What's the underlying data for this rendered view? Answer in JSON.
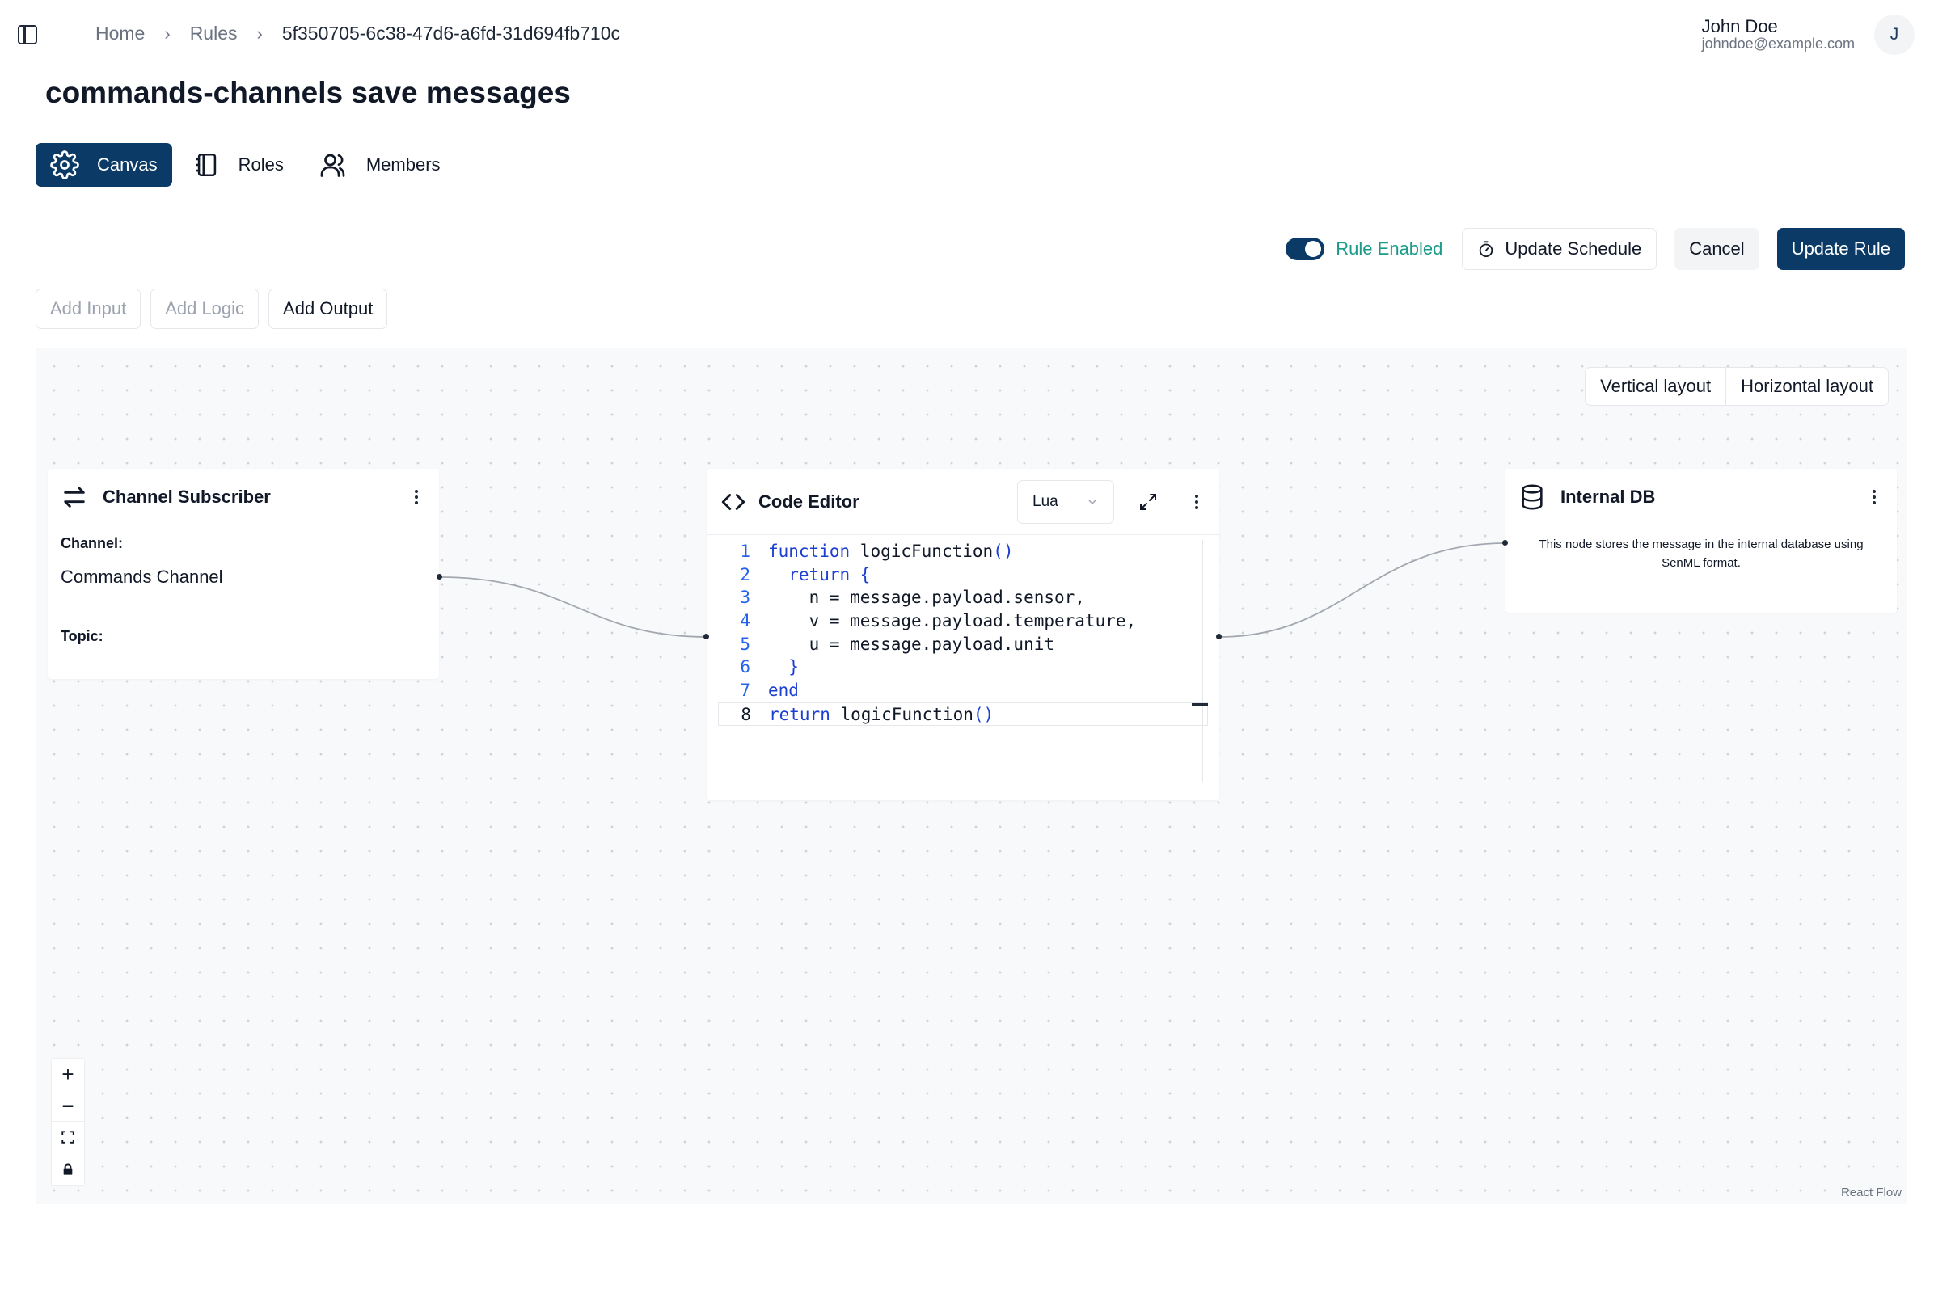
{
  "breadcrumb": {
    "home": "Home",
    "rules": "Rules",
    "current": "5f350705-6c38-47d6-a6fd-31d694fb710c",
    "separator": "›"
  },
  "user": {
    "name": "John Doe",
    "email": "johndoe@example.com",
    "initial": "J"
  },
  "page": {
    "title": "commands-channels save messages"
  },
  "tabs": [
    {
      "label": "Canvas",
      "icon": "gear-icon",
      "active": true
    },
    {
      "label": "Roles",
      "icon": "notebook-icon",
      "active": false
    },
    {
      "label": "Members",
      "icon": "users-icon",
      "active": false
    }
  ],
  "actions": {
    "rule_enabled_label": "Rule Enabled",
    "rule_enabled": true,
    "update_schedule": "Update Schedule",
    "cancel": "Cancel",
    "update_rule": "Update Rule"
  },
  "add_buttons": {
    "input": "Add Input",
    "logic": "Add Logic",
    "output": "Add Output"
  },
  "canvas": {
    "vertical_layout": "Vertical layout",
    "horizontal_layout": "Horizontal layout",
    "attribution": "React Flow"
  },
  "nodes": {
    "subscriber": {
      "title": "Channel Subscriber",
      "icon": "arrows-exchange-icon",
      "channel_label": "Channel:",
      "channel_value": "Commands Channel",
      "topic_label": "Topic:"
    },
    "code_editor": {
      "title": "Code Editor",
      "icon": "code-brackets-icon",
      "language": "Lua",
      "line_numbers": [
        "1",
        "2",
        "3",
        "4",
        "5",
        "6",
        "7",
        "8"
      ],
      "lines": [
        [
          {
            "t": "function",
            "k": true
          },
          {
            "t": " logicFunction",
            "k": false
          },
          {
            "t": "()",
            "k": true
          }
        ],
        [
          {
            "t": "  return",
            "k": true
          },
          {
            "t": " {",
            "k": true
          }
        ],
        [
          {
            "t": "    n = message.payload.sensor,",
            "k": false
          }
        ],
        [
          {
            "t": "    v = message.payload.temperature,",
            "k": false
          }
        ],
        [
          {
            "t": "    u = message.payload.unit",
            "k": false
          }
        ],
        [
          {
            "t": "  }",
            "k": true
          }
        ],
        [
          {
            "t": "end",
            "k": true
          }
        ],
        [
          {
            "t": "return",
            "k": true
          },
          {
            "t": " logicFunction",
            "k": false
          },
          {
            "t": "()",
            "k": true
          }
        ]
      ]
    },
    "internal_db": {
      "title": "Internal DB",
      "icon": "database-icon",
      "description": "This node stores the message in the internal database using SenML format."
    }
  },
  "zoom_controls": {
    "zoom_in": "+",
    "zoom_out": "−"
  },
  "colors": {
    "primary": "#0b3a66",
    "enabled_text": "#1a9b8a",
    "keyword": "#1d3fd3"
  }
}
